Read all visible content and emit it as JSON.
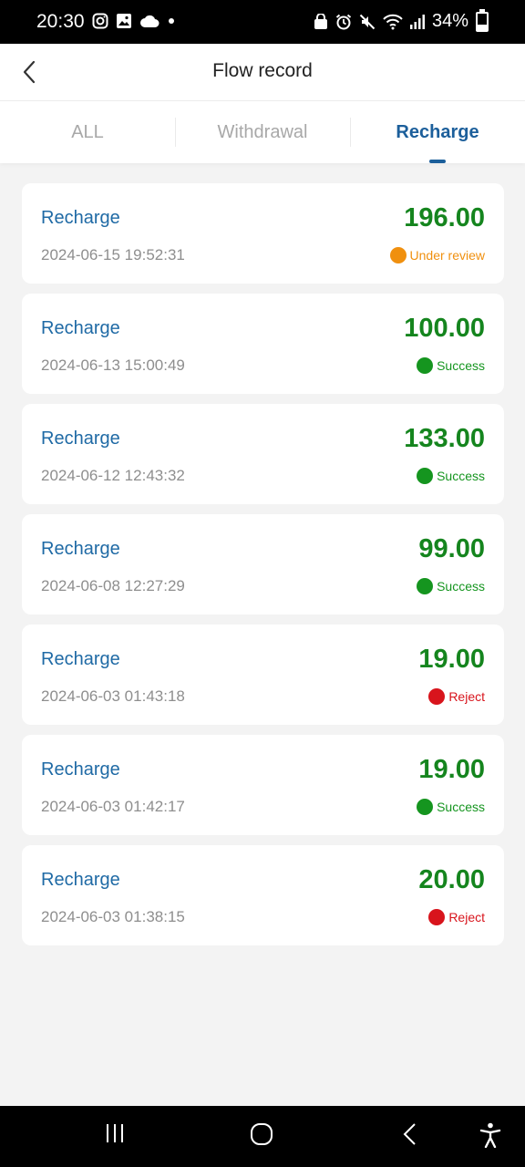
{
  "status_bar": {
    "time": "20:30",
    "battery": "34%"
  },
  "header": {
    "title": "Flow record"
  },
  "tabs": [
    {
      "label": "ALL",
      "active": false
    },
    {
      "label": "Withdrawal",
      "active": false
    },
    {
      "label": "Recharge",
      "active": true
    }
  ],
  "records": [
    {
      "type": "Recharge",
      "date": "2024-06-15 19:52:31",
      "amount": "196.00",
      "status": "Under review",
      "status_color": "#f0900f"
    },
    {
      "type": "Recharge",
      "date": "2024-06-13 15:00:49",
      "amount": "100.00",
      "status": "Success",
      "status_color": "#15951f"
    },
    {
      "type": "Recharge",
      "date": "2024-06-12 12:43:32",
      "amount": "133.00",
      "status": "Success",
      "status_color": "#15951f"
    },
    {
      "type": "Recharge",
      "date": "2024-06-08 12:27:29",
      "amount": "99.00",
      "status": "Success",
      "status_color": "#15951f"
    },
    {
      "type": "Recharge",
      "date": "2024-06-03 01:43:18",
      "amount": "19.00",
      "status": "Reject",
      "status_color": "#d8141c"
    },
    {
      "type": "Recharge",
      "date": "2024-06-03 01:42:17",
      "amount": "19.00",
      "status": "Success",
      "status_color": "#15951f"
    },
    {
      "type": "Recharge",
      "date": "2024-06-03 01:38:15",
      "amount": "20.00",
      "status": "Reject",
      "status_color": "#d8141c"
    }
  ],
  "colors": {
    "accent": "#1c5f9b",
    "amount": "#15851e"
  }
}
